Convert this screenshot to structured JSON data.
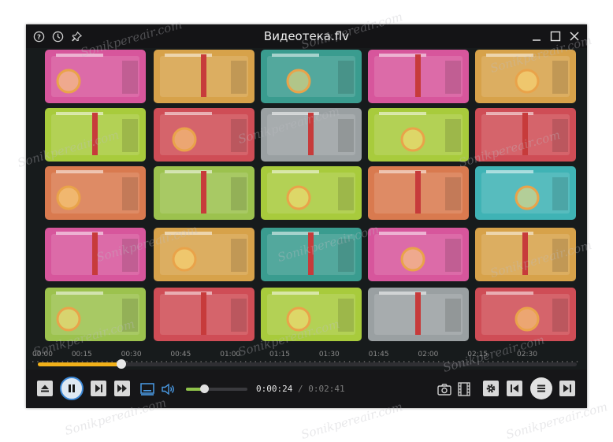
{
  "window": {
    "title": "Видеотека.flv",
    "title_icons": [
      "help-icon",
      "clock-icon",
      "pin-icon"
    ],
    "window_controls": [
      "minimize-icon",
      "maximize-icon",
      "close-icon"
    ]
  },
  "timeline": {
    "labels": [
      "00:00",
      "00:15",
      "00:30",
      "00:45",
      "01:00",
      "01:15",
      "01:30",
      "01:45",
      "02:00",
      "02:15",
      "02:30"
    ],
    "progress": 0.155,
    "progress_color": "#f2b21a"
  },
  "playback": {
    "current_time": "0:00:24",
    "separator": "/",
    "duration": "0:02:41",
    "volume": 0.3,
    "volume_color": "#8fc24a",
    "accent": "#3b87d6"
  },
  "controls": {
    "left": [
      "eject-icon",
      "pause-icon",
      "next-frame-icon",
      "fast-forward-icon",
      "subtitles-icon",
      "volume-icon"
    ],
    "right": [
      "camera-icon",
      "film-icon",
      "gear-icon",
      "previous-icon",
      "menu-icon",
      "next-icon"
    ]
  },
  "watermark": "Sonikpereair.com"
}
